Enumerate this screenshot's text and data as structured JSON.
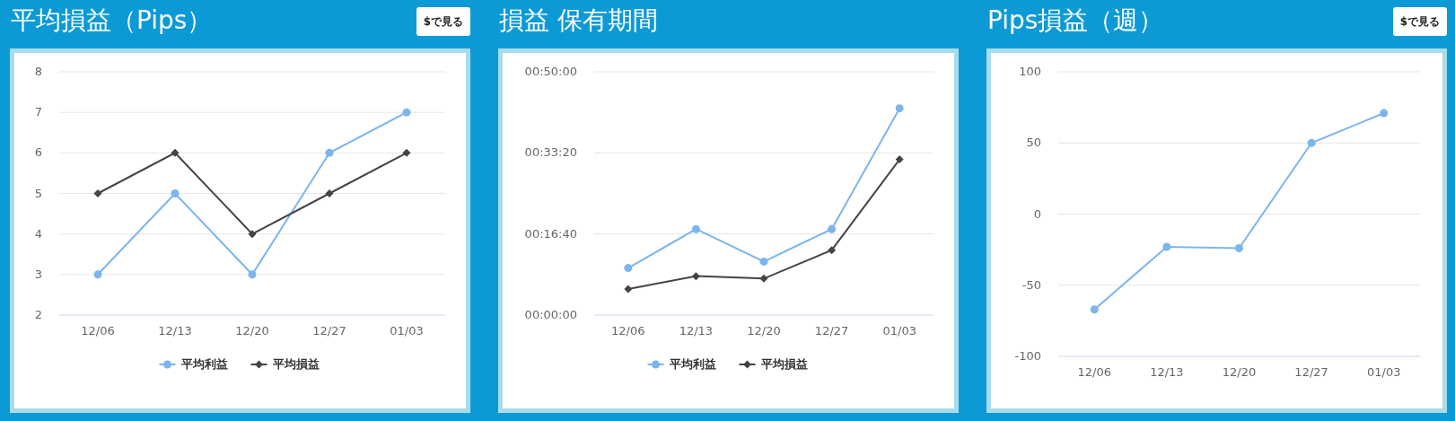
{
  "panels": [
    {
      "title": "平均損益（Pips）",
      "button": "$で見る",
      "chart_data": {
        "type": "line",
        "categories": [
          "12/06",
          "12/13",
          "12/20",
          "12/27",
          "01/03"
        ],
        "ylim": [
          2,
          8
        ],
        "yticks": [
          2,
          3,
          4,
          5,
          6,
          7,
          8
        ],
        "grid": true,
        "legend": "bottom",
        "series": [
          {
            "name": "平均利益",
            "color": "#7cb5ec",
            "marker": "circle",
            "values": [
              3,
              5,
              3,
              6,
              7
            ]
          },
          {
            "name": "平均損益",
            "color": "#434348",
            "marker": "diamond",
            "values": [
              5,
              6,
              4,
              5,
              6
            ]
          }
        ]
      }
    },
    {
      "title": "損益 保有期間",
      "chart_data": {
        "type": "line",
        "categories": [
          "12/06",
          "12/13",
          "12/20",
          "12/27",
          "01/03"
        ],
        "ylim": [
          0,
          3000
        ],
        "yticks": [
          {
            "value": 0,
            "label": "00:00:00"
          },
          {
            "value": 1000,
            "label": "00:16:40"
          },
          {
            "value": 2000,
            "label": "00:33:20"
          },
          {
            "value": 3000,
            "label": "00:50:00"
          }
        ],
        "grid": true,
        "legend": "bottom",
        "series": [
          {
            "name": "平均利益",
            "color": "#7cb5ec",
            "marker": "circle",
            "values": [
              580,
              1060,
              660,
              1060,
              2550
            ]
          },
          {
            "name": "平均損益",
            "color": "#434348",
            "marker": "diamond",
            "values": [
              320,
              480,
              450,
              800,
              1920
            ]
          }
        ]
      }
    },
    {
      "title": "Pips損益（週）",
      "button": "$で見る",
      "chart_data": {
        "type": "line",
        "categories": [
          "12/06",
          "12/13",
          "12/20",
          "12/27",
          "01/03"
        ],
        "ylim": [
          -100,
          100
        ],
        "yticks": [
          -100,
          -50,
          0,
          50,
          100
        ],
        "grid": true,
        "series": [
          {
            "color": "#7cb5ec",
            "marker": "circle",
            "values": [
              -67,
              -23,
              -24,
              50,
              71
            ]
          }
        ]
      }
    }
  ]
}
